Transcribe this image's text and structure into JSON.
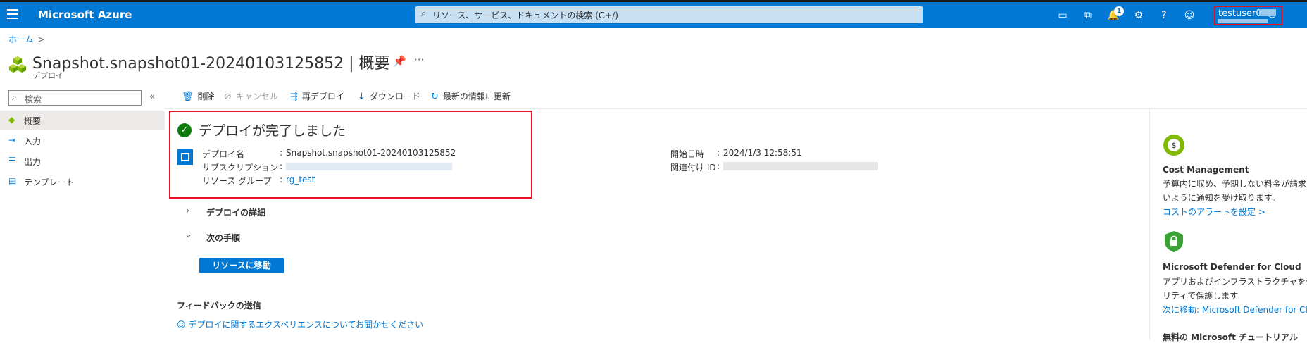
{
  "topbar": {
    "brand": "Microsoft Azure",
    "search_placeholder": "リソース、サービス、ドキュメントの検索 (G+/)",
    "notification_count": "1",
    "user": "testuser01@"
  },
  "breadcrumb": {
    "home": "ホーム",
    "separator": ">"
  },
  "header": {
    "title": "Snapshot.snapshot01-20240103125852 | 概要",
    "subtitle": "デプロイ",
    "more": "···"
  },
  "sidebar": {
    "search_placeholder": "検索",
    "collapse": "«",
    "items": [
      {
        "label": "概要",
        "icon": "deployment-icon",
        "active": true
      },
      {
        "label": "入力",
        "icon": "input-icon",
        "active": false
      },
      {
        "label": "出力",
        "icon": "output-icon",
        "active": false
      },
      {
        "label": "テンプレート",
        "icon": "template-icon",
        "active": false
      }
    ]
  },
  "toolbar": {
    "delete": "削除",
    "cancel": "キャンセル",
    "redeploy": "再デプロイ",
    "download": "ダウンロード",
    "refresh": "最新の情報に更新"
  },
  "deployment": {
    "status_title": "デプロイが完了しました",
    "name_label": "デプロイ名",
    "name_value": "Snapshot.snapshot01-20240103125852",
    "subscription_label": "サブスクリプション",
    "resource_group_label": "リソース グループ",
    "resource_group_value": "rg_test",
    "start_time_label": "開始日時",
    "start_time_value": "2024/1/3 12:58:51",
    "correlation_label": "関連付け ID",
    "colon": ":"
  },
  "sections": {
    "details": "デプロイの詳細",
    "next_steps": "次の手順",
    "go_to_resource": "リソースに移動",
    "feedback_title": "フィードバックの送信",
    "feedback_link": "デプロイに関するエクスペリエンスについてお聞かせください"
  },
  "right_panel": {
    "cost": {
      "title": "Cost Management",
      "line1": "予算内に収め、予期しない料金が請求さ",
      "line2": "いように通知を受け取ります。",
      "link": "コストのアラートを設定 >"
    },
    "defender": {
      "title": "Microsoft Defender for Cloud",
      "line1": "アプリおよびインフラストラクチャをセ",
      "line2": "リティで保護します",
      "link": "次に移動: Microsoft Defender for Cloud"
    },
    "tutorial": {
      "title": "無料の Microsoft チュートリアル"
    }
  },
  "colors": {
    "accent": "#0078d4",
    "success": "#107c10",
    "highlight": "#e81123"
  }
}
